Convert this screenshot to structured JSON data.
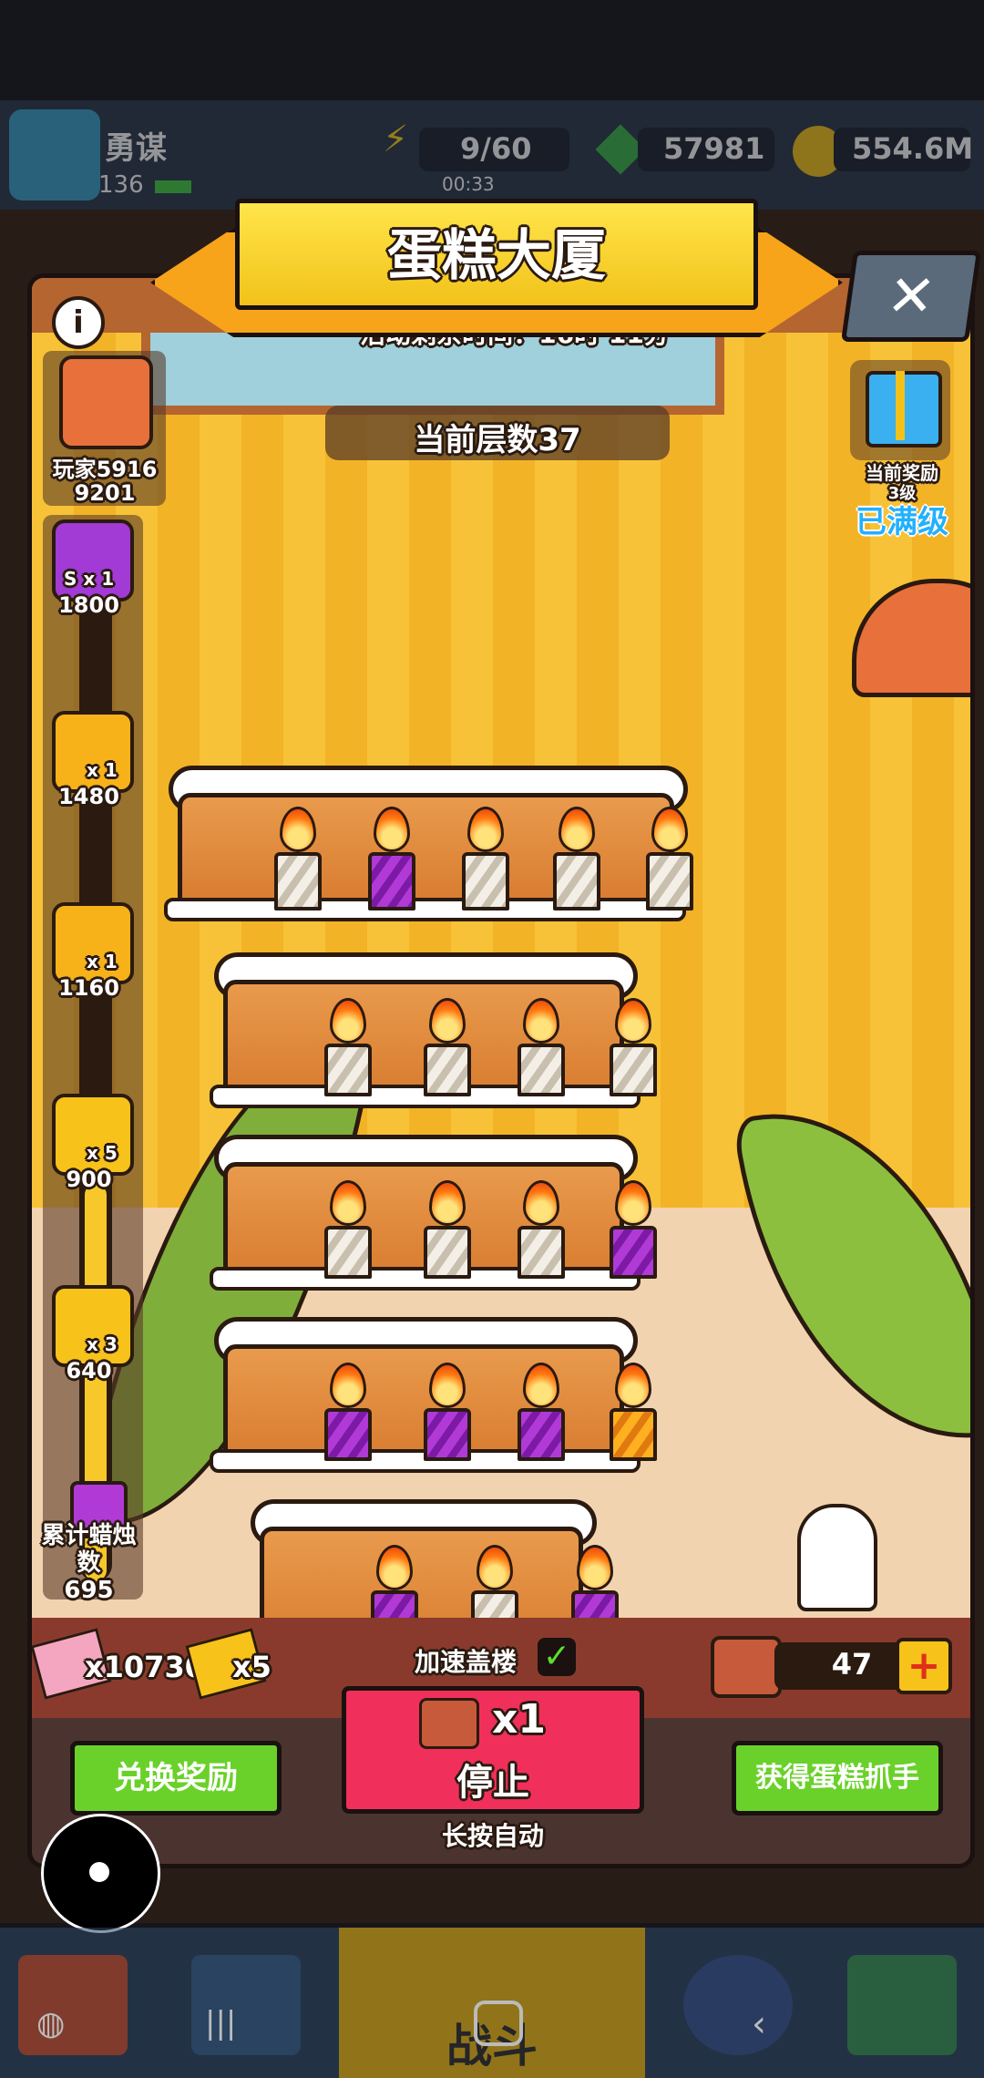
{
  "top_bar": {
    "player_name": "勇谋",
    "level": "136",
    "energy": "9/60",
    "energy_timer": "00:33",
    "gems": "57981",
    "gold": "554.6M"
  },
  "modal": {
    "title": "蛋糕大厦",
    "time_left": "活动剩余时间：16时 11分",
    "current_floor": "当前层数37",
    "player": {
      "name": "玩家5916",
      "score": "9201"
    },
    "current_reward": {
      "label": "当前奖励",
      "level": "3级",
      "status": "已满级"
    },
    "rewards": [
      {
        "qty": "S x 1",
        "threshold": "1800",
        "icon": "purple-chest-icon"
      },
      {
        "qty": "x 1",
        "threshold": "1480",
        "icon": "gold-chest-icon"
      },
      {
        "qty": "x 1",
        "threshold": "1160",
        "icon": "mystery-chest-icon"
      },
      {
        "qty": "x 5",
        "threshold": "900",
        "icon": "key-icon"
      },
      {
        "qty": "x 3",
        "threshold": "640",
        "icon": "key-icon"
      }
    ],
    "candle_count": {
      "label": "累计蜡烛数",
      "value": "695"
    },
    "inventory": {
      "pink_ticket": "x10730",
      "gold_ticket": "x5",
      "speed_label": "加速盖楼",
      "speed_enabled": true,
      "cake_count": "47"
    },
    "buttons": {
      "exchange": "兑换奖励",
      "main_multiplier": "x1",
      "main_label": "停止",
      "hold_hint": "长按自动",
      "claw": "获得蛋糕抓手"
    }
  },
  "bottom_nav": {
    "battle_label": "战斗"
  },
  "colors": {
    "title_yellow": "#f9d21c",
    "button_green": "#6ad12a",
    "button_pink": "#f0305a",
    "maxed_blue": "#22b0ff"
  }
}
